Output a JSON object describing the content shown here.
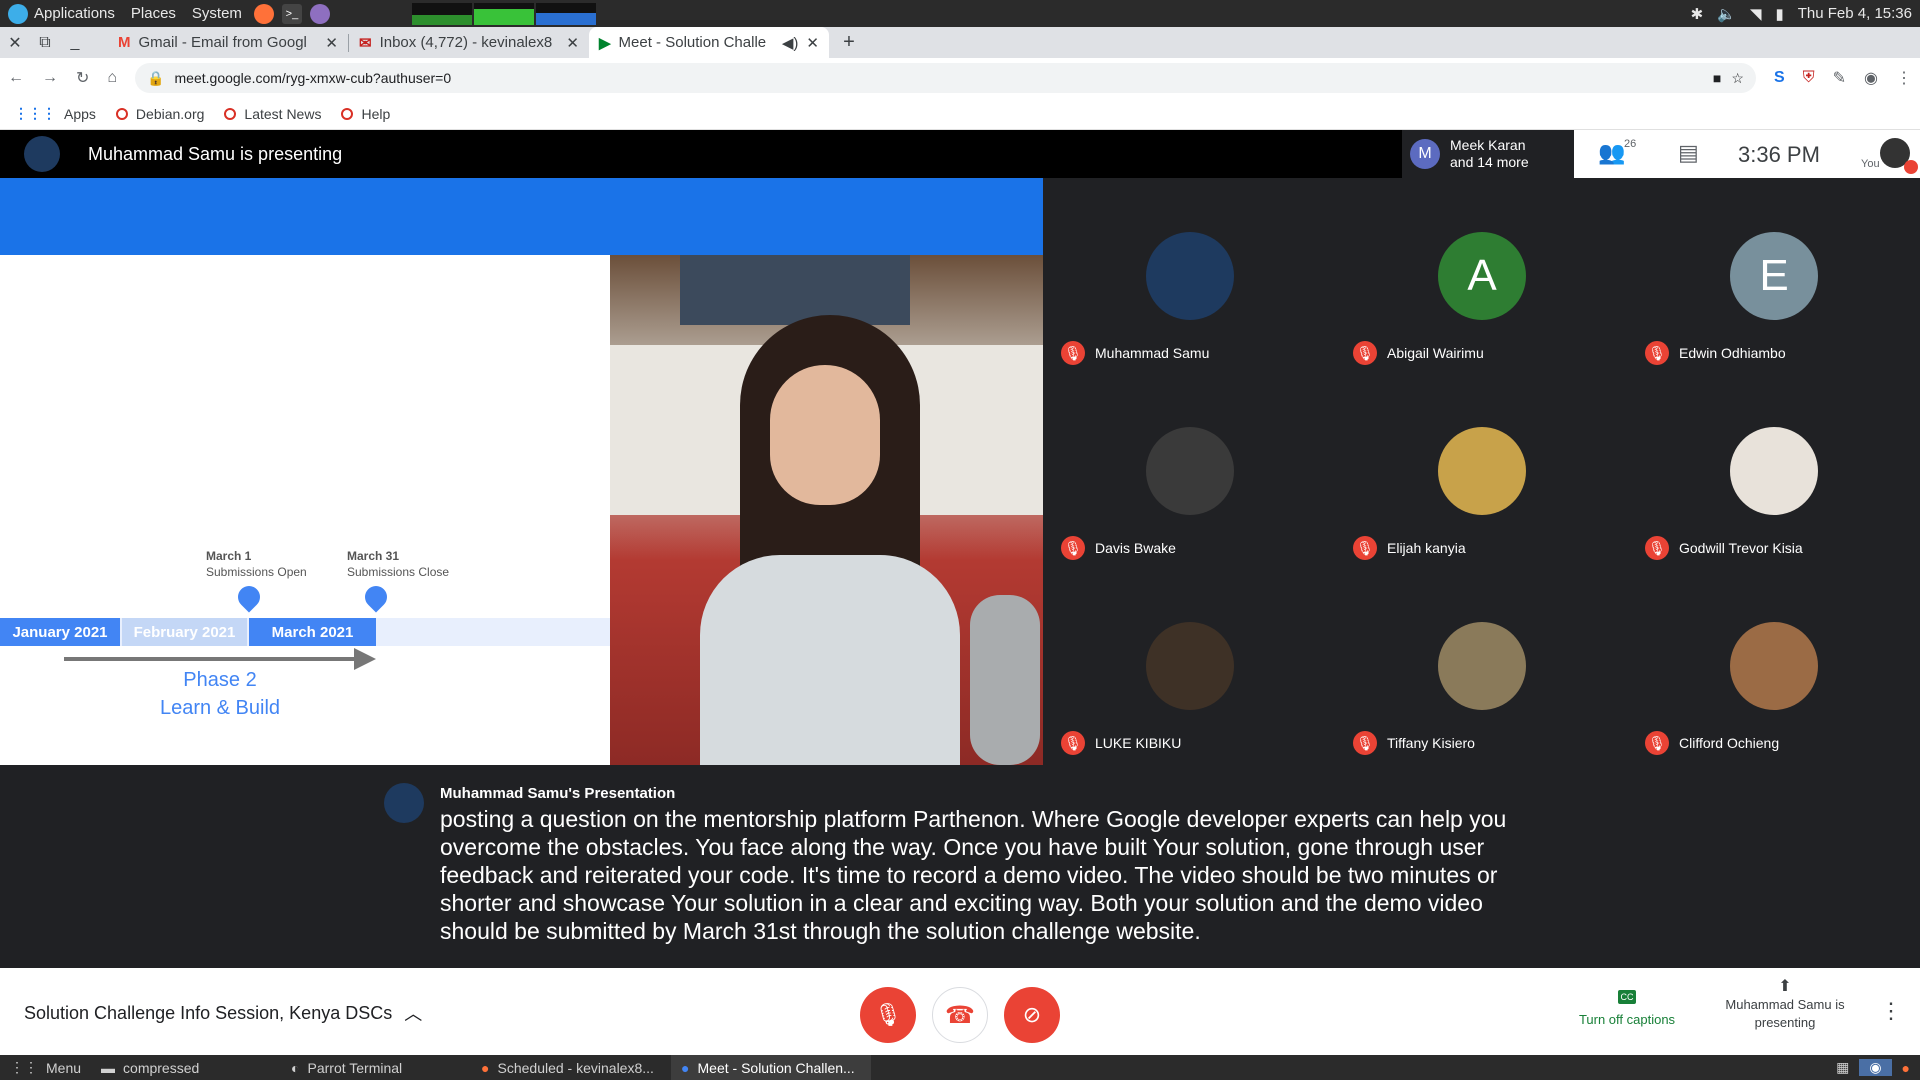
{
  "os_panel": {
    "menus": [
      "Applications",
      "Places",
      "System"
    ],
    "datetime": "Thu Feb 4, 15:36"
  },
  "browser": {
    "tabs": [
      {
        "title": "Gmail - Email from Googl",
        "icon": "gmail-icon"
      },
      {
        "title": "Inbox (4,772) - kevinalex8",
        "icon": "mail-icon"
      },
      {
        "title": "Meet - Solution Challe",
        "icon": "meet-icon",
        "active": true
      }
    ],
    "new_tab": "+",
    "url": "meet.google.com/ryg-xmxw-cub?authuser=0",
    "bookmarks": [
      "Apps",
      "Debian.org",
      "Latest News",
      "Help"
    ]
  },
  "meet": {
    "presenting_banner": "Muhammad Samu is presenting",
    "participants_pill": {
      "initial": "M",
      "line1": "Meek Karan",
      "line2": "and 14 more"
    },
    "participant_count": "26",
    "clock": "3:36 PM",
    "self_label": "You",
    "slide": {
      "timeline": [
        "January 2021",
        "February 2021",
        "March 2021"
      ],
      "markers": [
        {
          "title": "March 1",
          "sub": "Submissions Open"
        },
        {
          "title": "March 31",
          "sub": "Submissions Close"
        }
      ],
      "phase_title": "Phase 2",
      "phase_sub": "Learn & Build"
    },
    "participants": [
      {
        "name": "Muhammad Samu",
        "initial": "",
        "color": "#1e3a5f"
      },
      {
        "name": "Abigail Wairimu",
        "initial": "A",
        "color": "#2e7d32"
      },
      {
        "name": "Edwin Odhiambo",
        "initial": "E",
        "color": "#78909c"
      },
      {
        "name": "Davis Bwake",
        "initial": "",
        "color": "#3a3a3a"
      },
      {
        "name": "Elijah kanyia",
        "initial": "",
        "color": "#c8a24a"
      },
      {
        "name": "Godwill Trevor Kisia",
        "initial": "",
        "color": "#e8e2da"
      },
      {
        "name": "LUKE KIBIKU",
        "initial": "",
        "color": "#3e3126"
      },
      {
        "name": "Tiffany Kisiero",
        "initial": "",
        "color": "#8a7a5a"
      },
      {
        "name": "Clifford Ochieng",
        "initial": "",
        "color": "#9b6b45"
      }
    ],
    "captions": {
      "speaker": "Muhammad Samu's Presentation",
      "text": "posting a question on the mentorship platform Parthenon. Where Google developer experts can help you overcome the obstacles. You face along the way. Once you have built Your solution, gone through user feedback and reiterated your code. It's time to record a demo video. The video should be two minutes or shorter and showcase Your solution in a clear and exciting way. Both your solution and the demo video should be submitted by March 31st through the solution challenge website."
    },
    "meeting_title": "Solution Challenge Info Session, Kenya DSCs",
    "captions_button": "Turn off captions",
    "presenting_button": "Muhammad Samu is presenting",
    "colors": {
      "hangup_red": "#ea4335",
      "brand_blue": "#1a73e8",
      "caption_green": "#188038"
    }
  },
  "taskbar": {
    "items": [
      "Menu",
      "compressed",
      "Parrot Terminal",
      "Scheduled - kevinalex8...",
      "Meet - Solution Challen..."
    ]
  }
}
